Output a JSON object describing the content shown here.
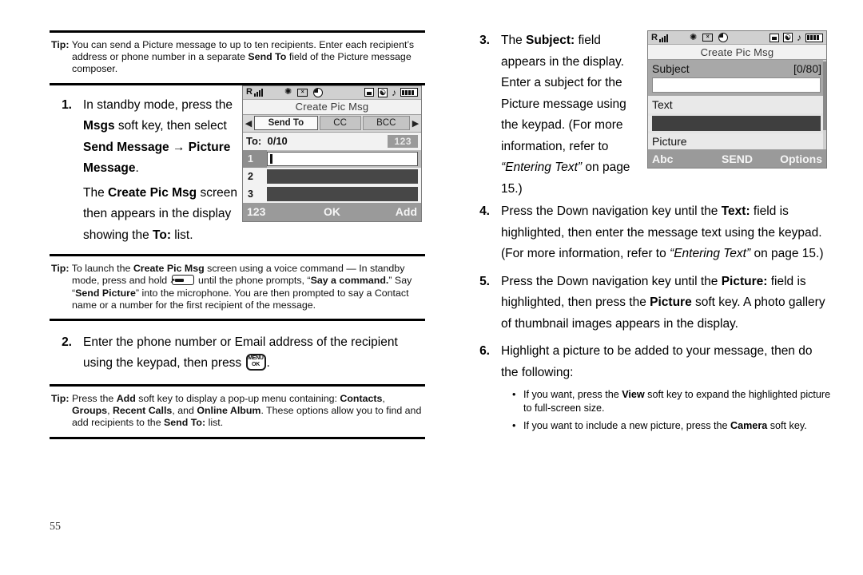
{
  "page": {
    "number": "55"
  },
  "left_column": {
    "tip1": {
      "label": "Tip:",
      "text_parts": [
        {
          "t": "You can send a Picture message to up to ten recipients. Enter each recipient’s address or phone number in a separate ",
          "b": false
        },
        {
          "t": "Send To",
          "b": true
        },
        {
          "t": " field of the Picture message composer.",
          "b": false
        }
      ]
    },
    "step1": {
      "num": "1.",
      "parts": [
        {
          "t": "In standby mode, press the ",
          "b": false
        },
        {
          "t": "Msgs",
          "b": true
        },
        {
          "t": " soft key, then select ",
          "b": false
        },
        {
          "t": "Send Message → Picture Message",
          "b": true
        },
        {
          "t": ".",
          "b": false
        }
      ],
      "parts2": [
        {
          "t": "The ",
          "b": false
        },
        {
          "t": "Create Pic Msg",
          "b": true
        },
        {
          "t": " screen then appears in the display showing the ",
          "b": false
        },
        {
          "t": "To:",
          "b": true
        },
        {
          "t": " list.",
          "b": false
        }
      ]
    },
    "tip2": {
      "label": "Tip:",
      "pre": "To launch the ",
      "b1": "Create Pic Msg",
      "mid1": " screen using a voice command — In standby mode, press and hold ",
      "key": "send-key-icon",
      "mid2": " until the phone prompts, “",
      "b2": "Say a command.",
      "mid3": "” Say “",
      "b3": "Send Picture",
      "post": "” into the microphone. You are then prompted to say a Contact name or a number for the first recipient of the message."
    },
    "step2": {
      "num": "2.",
      "pre": "Enter the phone number or Email address of the recipient using the keypad, then press ",
      "key_top": "MENU",
      "key_bottom": "OK",
      "post": "."
    },
    "tip3": {
      "label": "Tip:",
      "pre": "Press the ",
      "b1": "Add",
      "mid1": " soft key to display a pop-up menu containing: ",
      "b2": "Contacts",
      "mid2": ", ",
      "b3": "Groups",
      "mid3": ", ",
      "b4": "Recent Calls",
      "mid4": ", and ",
      "b5": "Online Album",
      "mid5": ". These options allow you to find and add recipients to the ",
      "b6": "Send To:",
      "post": " list."
    }
  },
  "right_column": {
    "step3": {
      "num": "3.",
      "p1": "The ",
      "b1": "Subject:",
      "p2": " field appears in the display. Enter a subject for the Picture message using the keypad. (For more information, refer to ",
      "i1": "“Entering Text”",
      "p3": " on page 15.)"
    },
    "step4": {
      "num": "4.",
      "p1": "Press the Down navigation key until the ",
      "b1": "Text:",
      "p2": " field is highlighted, then enter the message text using the keypad. (For more information, refer to ",
      "i1": "“Entering Text”",
      "p3": " on page 15.)"
    },
    "step5": {
      "num": "5.",
      "p1": "Press the Down navigation key until the ",
      "b1": "Picture:",
      "p2": " field is highlighted, then press the ",
      "b2": "Picture",
      "p3": " soft key. A photo gallery of thumbnail images appears in the display."
    },
    "step6": {
      "num": "6.",
      "p1": "Highlight a picture to be added to your message, then do the following:",
      "bullets": [
        {
          "dot": "•",
          "p1": "If you want, press the ",
          "b1": "View",
          "p2": " soft key to expand the highlighted picture to full-screen size."
        },
        {
          "dot": "•",
          "p1": "If you want to include a new picture, press the ",
          "b1": "Camera",
          "p2": " soft key."
        }
      ]
    }
  },
  "phone_screen_1": {
    "status_icons": [
      "roaming-signal-icon",
      "alarm-icon",
      "message-icon",
      "clock-icon",
      "lock-icon",
      "bluetooth-icon",
      "music-note-icon",
      "battery-icon"
    ],
    "signal_label": "R",
    "title": "Create Pic Msg",
    "left_arrow": "◀",
    "right_arrow": "▶",
    "tabs": [
      {
        "label": "Send To",
        "active": true
      },
      {
        "label": "CC",
        "active": false
      },
      {
        "label": "BCC",
        "active": false
      }
    ],
    "to_label": "To:",
    "to_count": "0/10",
    "mode_chip": "123",
    "rows": [
      {
        "index": "1",
        "selected": true
      },
      {
        "index": "2",
        "selected": false
      },
      {
        "index": "3",
        "selected": false
      }
    ],
    "softkeys": {
      "left": "123",
      "center": "OK",
      "right": "Add"
    }
  },
  "phone_screen_2": {
    "status_icons": [
      "roaming-signal-icon",
      "alarm-icon",
      "message-icon",
      "clock-icon",
      "lock-icon",
      "bluetooth-icon",
      "music-note-icon",
      "battery-icon"
    ],
    "signal_label": "R",
    "title": "Create Pic Msg",
    "fields": [
      {
        "label": "Subject",
        "counter": "[0/80]",
        "highlighted": true,
        "input": "white"
      },
      {
        "label": "Text",
        "counter": "",
        "highlighted": false,
        "input": "dark"
      },
      {
        "label": "Picture",
        "counter": "",
        "highlighted": false,
        "input": "none"
      }
    ],
    "softkeys": {
      "left": "Abc",
      "center": "SEND",
      "right": "Options"
    }
  },
  "colors": {
    "screen_bg": "#d7d7d7",
    "softkey_bar": "#9a9a9a",
    "highlight": "#a8a8a8",
    "dark_field": "#3f3f3f",
    "text": "#000000"
  }
}
